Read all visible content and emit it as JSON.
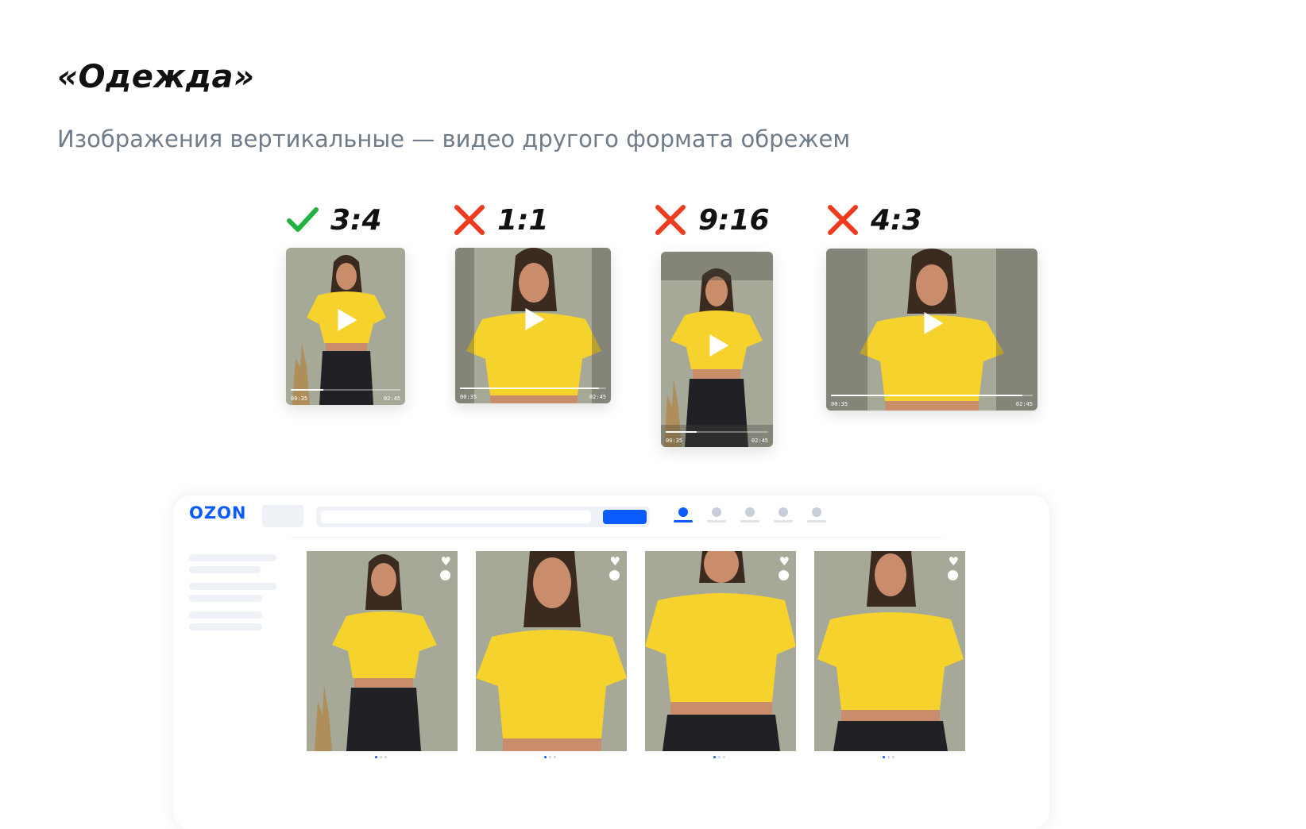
{
  "header": {
    "title": "«Одежда»",
    "subtitle": "Изображения вертикальные — видео другого формата обрежем"
  },
  "formats": [
    {
      "ratio": "3:4",
      "status": "ok",
      "time_start": "00:35",
      "time_end": "02:45",
      "progress": 0.3
    },
    {
      "ratio": "1:1",
      "status": "no",
      "time_start": "00:35",
      "time_end": "02:45",
      "progress": 0.95
    },
    {
      "ratio": "9:16",
      "status": "no",
      "time_start": "00:35",
      "time_end": "02:45",
      "progress": 0.3
    },
    {
      "ratio": "4:3",
      "status": "no",
      "time_start": "00:35",
      "time_end": "02:45",
      "progress": 0.95
    }
  ],
  "mock": {
    "logo": "OZON",
    "nav_icons": [
      "profile-icon",
      "orders-icon",
      "notifications-icon",
      "favorites-icon",
      "cart-icon"
    ],
    "active_nav_index": 0,
    "products": [
      {
        "favorite_icon": "heart-icon",
        "image": "model-full"
      },
      {
        "favorite_icon": "heart-icon",
        "image": "model-close"
      },
      {
        "favorite_icon": "heart-icon",
        "image": "model-close"
      },
      {
        "favorite_icon": "heart-icon",
        "image": "model-close"
      }
    ]
  },
  "colors": {
    "ok": "#1fb141",
    "no": "#ee3b1f",
    "brand": "#0b5bff",
    "shirt": "#f6d32c",
    "backdrop": "#a6a898"
  }
}
